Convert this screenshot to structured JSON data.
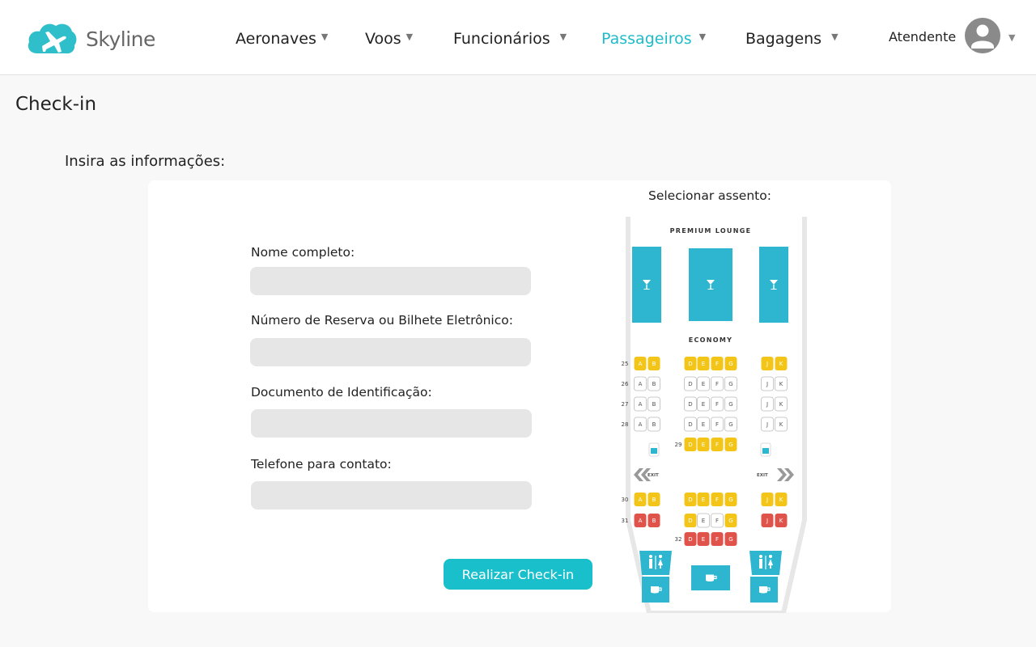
{
  "brand": {
    "name": "Skyline",
    "accent": "#1ebcc9"
  },
  "nav": {
    "items": [
      {
        "label": "Aeronaves",
        "caret": "▼"
      },
      {
        "label": "Voos",
        "caret": "▼"
      },
      {
        "label": "Funcionários",
        "caret": "▼"
      },
      {
        "label": "Passageiros",
        "caret": "▼",
        "active": true
      },
      {
        "label": "Bagagens",
        "caret": "▼"
      }
    ]
  },
  "user": {
    "role": "Atendente",
    "caret": "▼",
    "avatar_icon": "user-avatar-icon"
  },
  "page": {
    "title": "Check-in",
    "subtitle": "Insira as informações:"
  },
  "form": {
    "fields": [
      {
        "label": "Nome completo:",
        "value": ""
      },
      {
        "label": "Número de Reserva ou Bilhete Eletrônico:",
        "value": ""
      },
      {
        "label": "Documento de Identificação:",
        "value": ""
      },
      {
        "label": "Telefone para contato:",
        "value": ""
      }
    ],
    "submit_label": "Realizar Check-in"
  },
  "seat_map": {
    "title": "Selecionar assento:",
    "sections": {
      "premium": "PREMIUM LOUNGE",
      "economy": "ECONOMY",
      "exit": "EXIT"
    },
    "rows": [
      "25",
      "26",
      "27",
      "28",
      "29",
      "30",
      "31",
      "32"
    ],
    "colors": {
      "available": "#f2c518",
      "occupied": "#e0534a",
      "free": "#ffffff",
      "lounge": "#2eb5cf"
    }
  }
}
